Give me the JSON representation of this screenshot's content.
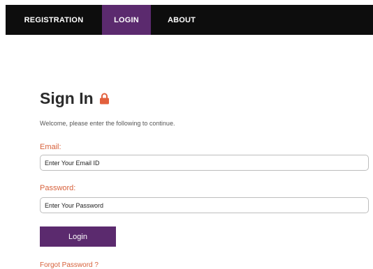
{
  "nav": {
    "items": [
      {
        "label": "REGISTRATION"
      },
      {
        "label": "LOGIN",
        "active": true
      },
      {
        "label": "ABOUT"
      }
    ]
  },
  "signin": {
    "title": "Sign In",
    "icon": "lock-icon",
    "welcome": "Welcome, please enter the following to continue."
  },
  "form": {
    "email_label": "Email:",
    "email_placeholder": "Enter Your Email ID",
    "password_label": "Password:",
    "password_placeholder": "Enter Your Password",
    "login_label": "Login",
    "forgot_label": "Forgot Password ?"
  },
  "colors": {
    "accent": "#5b2a6e",
    "label": "#d7603a",
    "navbar": "#0d0d0d"
  }
}
